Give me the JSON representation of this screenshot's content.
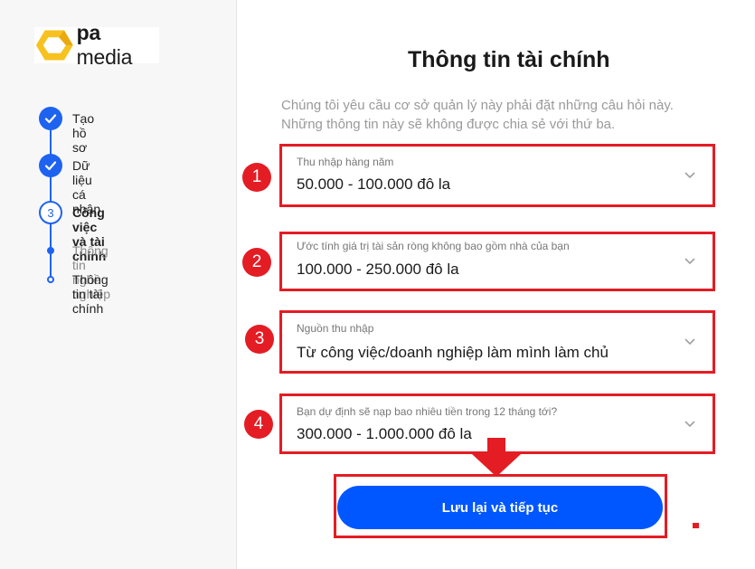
{
  "brand": {
    "name_bold": "pa",
    "name_rest": " media",
    "accent": "#F7C21F"
  },
  "sidebar": {
    "steps": [
      {
        "label": "Tạo hồ sơ",
        "state": "done",
        "icon": "check-icon"
      },
      {
        "label": "Dữ liệu cá nhân",
        "state": "done",
        "icon": "check-icon"
      },
      {
        "label": "Công việc và tài chính",
        "state": "current",
        "number": "3"
      }
    ],
    "substeps": [
      {
        "label": "Thông tin nghề nghiệp",
        "state": "done"
      },
      {
        "label": "Thông tin tài chính",
        "state": "current"
      }
    ]
  },
  "main": {
    "title": "Thông tin tài chính",
    "description": "Chúng tôi yêu cầu cơ sở quản lý này phải đặt những câu hỏi này. Những thông tin này sẽ không được chia sẻ với thứ ba.",
    "fields": [
      {
        "number": "1",
        "label": "Thu nhập hàng năm",
        "value": "50.000 - 100.000 đô la"
      },
      {
        "number": "2",
        "label": "Ước tính giá trị tài sản ròng không bao gồm nhà của bạn",
        "value": "100.000 - 250.000 đô la"
      },
      {
        "number": "3",
        "label": "Nguồn thu nhập",
        "value": "Từ công việc/doanh nghiệp làm mình làm chủ"
      },
      {
        "number": "4",
        "label": "Bạn dự định sẽ nạp bao nhiêu tiền trong 12 tháng tới?",
        "value": "300.000 - 1.000.000 đô la"
      }
    ],
    "save_label": "Lưu lại và tiếp tục"
  },
  "colors": {
    "primary": "#0057FF",
    "step_blue": "#1E63F0",
    "highlight_red": "#E41C24"
  }
}
